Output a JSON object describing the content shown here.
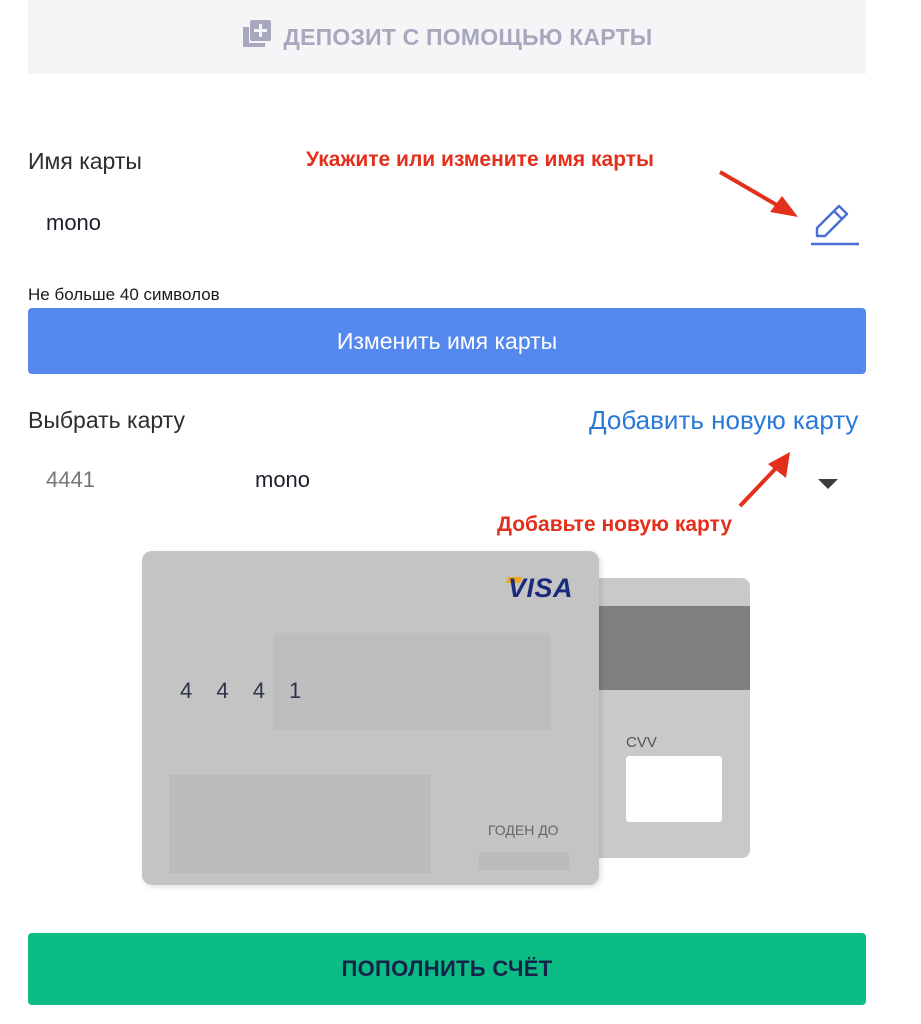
{
  "deposit_tab": {
    "label": "ДЕПОЗИТ С ПОМОЩЬЮ КАРТЫ",
    "icon": "add-to-queue-icon"
  },
  "card_name": {
    "label": "Имя карты",
    "value": "mono",
    "hint": "Не больше 40 символов",
    "annotation": "Укажите или измените имя карты",
    "edit_icon": "pencil-icon"
  },
  "rename_button": {
    "label": "Изменить имя карты"
  },
  "select_card": {
    "label": "Выбрать карту",
    "add_link": "Добавить новую карту",
    "selected_number": "4441",
    "selected_name": "mono",
    "annotation": "Добавьте новую карту",
    "dropdown_icon": "caret-down-icon"
  },
  "card_preview": {
    "brand": "VISA",
    "number_visible": "4 4 4 1",
    "cvv_label": "CVV",
    "expiry_label": "ГОДЕН ДО"
  },
  "topup_button": {
    "label": "ПОПОЛНИТЬ СЧЁТ"
  },
  "colors": {
    "primary_blue": "#5588ee",
    "link_blue": "#2b79d6",
    "annotation_red": "#e3301c",
    "topup_green": "#0bbd84"
  }
}
